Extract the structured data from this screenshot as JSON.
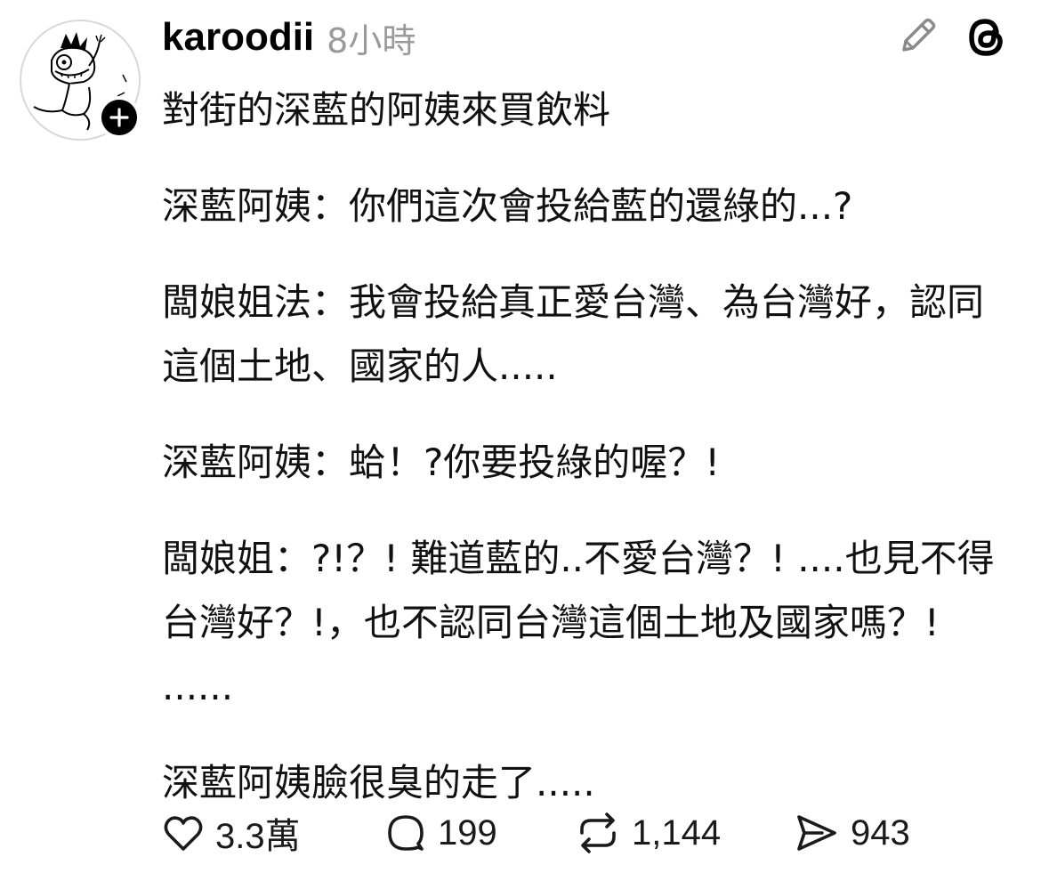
{
  "post": {
    "username": "karoodii",
    "timestamp": "8小時",
    "paragraphs": [
      "對街的深藍的阿姨來買飲料",
      "深藍阿姨：你們這次會投給藍的還綠的...?",
      "闆娘姐法：我會投給真正愛台灣、為台灣好，認同這個土地、國家的人.....",
      "深藍阿姨：蛤！?你要投綠的喔？!",
      "闆娘姐：?!？! 難道藍的..不愛台灣？! ....也見不得台灣好？!，也不認同台灣這個土地及國家嗎？! ......",
      "深藍阿姨臉很臭的走了....."
    ]
  },
  "actions": {
    "like_count": "3.3萬",
    "reply_count": "199",
    "repost_count": "1,144",
    "share_count": "943"
  },
  "icons": {
    "avatar": "cartoon-dinosaur-avatar",
    "follow": "plus-icon",
    "edit": "pencil-icon",
    "app": "threads-logo-icon",
    "like": "heart-icon",
    "reply": "speech-bubble-icon",
    "repost": "repost-arrows-icon",
    "share": "paper-plane-icon"
  },
  "colors": {
    "text": "#111111",
    "muted": "#9a9a9a",
    "icon": "#1a1a1a",
    "background": "#ffffff"
  }
}
